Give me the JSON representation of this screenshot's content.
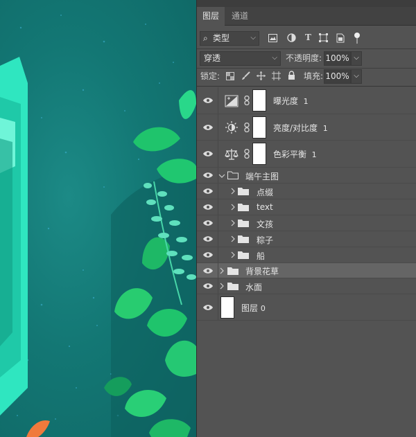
{
  "tabs": [
    {
      "label": "图层",
      "active": true
    },
    {
      "label": "通道",
      "active": false
    }
  ],
  "filter": {
    "kind_label": "类型",
    "icons": [
      "image-filter-icon",
      "adjustment-filter-icon",
      "type-filter-icon",
      "shape-filter-icon",
      "smart-object-filter-icon",
      "filter-toggle-icon"
    ]
  },
  "blend": {
    "mode": "穿透",
    "opacity_label": "不透明度:",
    "opacity_value": "100%"
  },
  "lock": {
    "label": "锁定:",
    "fill_label": "填充:",
    "fill_value": "100%"
  },
  "layers": [
    {
      "name": "曝光度",
      "suffix": "1",
      "type": "adjustment",
      "icon": "exposure-icon",
      "visible": true
    },
    {
      "name": "亮度/对比度",
      "suffix": "1",
      "type": "adjustment",
      "icon": "brightness-contrast-icon",
      "visible": true
    },
    {
      "name": "色彩平衡",
      "suffix": "1",
      "type": "adjustment",
      "icon": "color-balance-icon",
      "visible": true
    },
    {
      "name": "端午主图",
      "type": "group",
      "expanded": true,
      "visible": true
    },
    {
      "name": "点缀",
      "type": "group",
      "indent": 1,
      "visible": true
    },
    {
      "name": "text",
      "type": "group",
      "indent": 1,
      "visible": true
    },
    {
      "name": "文孩",
      "type": "group",
      "indent": 1,
      "visible": true
    },
    {
      "name": "粽子",
      "type": "group",
      "indent": 1,
      "visible": true
    },
    {
      "name": "船",
      "type": "group",
      "indent": 1,
      "visible": true
    },
    {
      "name": "背景花草",
      "type": "group",
      "selected": true,
      "visible": true
    },
    {
      "name": "水面",
      "type": "group",
      "visible": true
    },
    {
      "name": "图层",
      "suffix": "0",
      "type": "pixel",
      "visible": true
    }
  ],
  "colors": {
    "panel_bg": "#535353",
    "selected_row": "#656565",
    "canvas_teal": "#137774",
    "leaf_green": "#1fc46c",
    "boat_aqua": "#2fe6c0"
  }
}
